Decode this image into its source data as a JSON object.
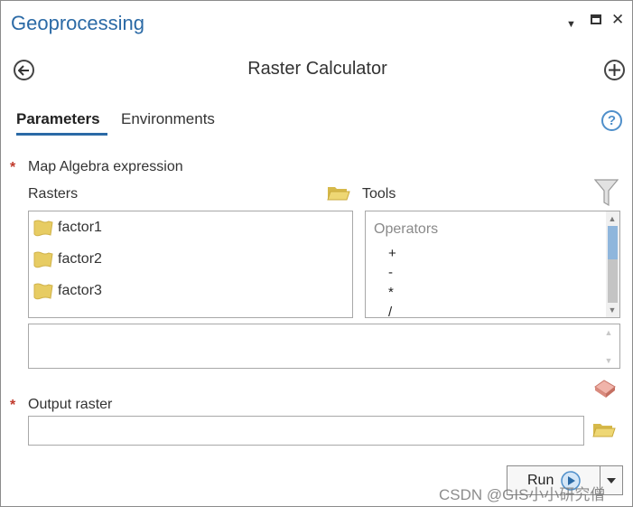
{
  "pane": {
    "title": "Geoprocessing",
    "menu_glyph": "▼",
    "maximize_glyph": "■",
    "close_glyph": "✕"
  },
  "tool": {
    "title": "Raster Calculator",
    "back_icon": "back-arrow-circle-icon",
    "add_icon": "add-circle-icon"
  },
  "tabs": [
    {
      "label": "Parameters",
      "active": true
    },
    {
      "label": "Environments",
      "active": false
    }
  ],
  "help": {
    "glyph": "?"
  },
  "map_algebra": {
    "required_mark": "*",
    "label": "Map Algebra expression",
    "rasters_label": "Rasters",
    "tools_label": "Tools",
    "rasters": [
      {
        "name": "factor1"
      },
      {
        "name": "factor2"
      },
      {
        "name": "factor3"
      }
    ],
    "operators_header": "Operators",
    "operators": [
      "+",
      "-",
      "*",
      "/"
    ],
    "expression_value": ""
  },
  "output_raster": {
    "required_mark": "*",
    "label": "Output raster",
    "value": ""
  },
  "run": {
    "label": "Run"
  },
  "watermark": "CSDN @GIS小小研究僧",
  "colors": {
    "accent": "#2b6aa6",
    "folder": "#e7cc63",
    "required": "#c0392b",
    "eraser": "#e39a8e"
  }
}
